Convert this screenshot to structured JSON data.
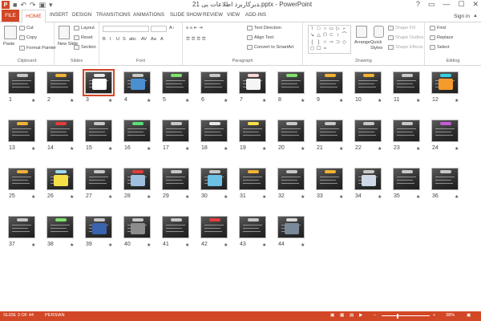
{
  "window": {
    "title": "ﺪﺑﺮﻛﺎﺭﺑﺮﺩ ﺍﻃﻼﻋﺎﺕ ﺑﯽ 21.pptx - PowerPoint",
    "app_logo": "P",
    "qat": [
      "save-icon",
      "undo-icon",
      "redo-icon",
      "start-from-beginning-icon",
      "customize-icon"
    ],
    "controls": [
      "?",
      "restore-icon",
      "minimize-icon",
      "maximize-icon",
      "close-icon"
    ]
  },
  "tabs": {
    "file": "FILE",
    "home": "HOME",
    "others": [
      "INSERT",
      "DESIGN",
      "TRANSITIONS",
      "ANIMATIONS",
      "SLIDE SHOW",
      "REVIEW",
      "VIEW",
      "ADD-INS"
    ],
    "signin": "Sign in"
  },
  "ribbon": {
    "clipboard": {
      "paste": "Paste",
      "cut": "Cut",
      "copy": "Copy",
      "format_painter": "Format Painter",
      "label": "Clipboard"
    },
    "slides": {
      "new_slide": "New Slide",
      "layout": "Layout",
      "reset": "Reset",
      "section": "Section",
      "label": "Slides"
    },
    "font": {
      "label": "Font",
      "buttons": [
        "B",
        "I",
        "U",
        "S",
        "abc",
        "AV",
        "Aa",
        "A"
      ]
    },
    "paragraph": {
      "label": "Paragraph",
      "text_direction": "Text Direction",
      "align_text": "Align Text",
      "convert_smartart": "Convert to SmartArt"
    },
    "drawing": {
      "label": "Drawing",
      "arrange": "Arrange",
      "quick_styles": "Quick Styles",
      "shape_fill": "Shape Fill",
      "shape_outline": "Shape Outline",
      "shape_effects": "Shape Effects",
      "shapes": [
        "\\",
        "□",
        "○",
        "▭",
        "▷",
        "⌐",
        "↘",
        "△",
        "⬠",
        "⊂",
        "↕",
        "⌒",
        "{",
        "}",
        "☆",
        "⇨",
        "⊃",
        "◇",
        "⬡",
        "☐",
        "≈"
      ]
    },
    "editing": {
      "label": "Editing",
      "find": "Find",
      "replace": "Replace",
      "select": "Select"
    }
  },
  "slides": [
    {
      "n": "1",
      "accent": "#c8c8c8",
      "pic": ""
    },
    {
      "n": "2",
      "accent": "#f2b233",
      "pic": ""
    },
    {
      "n": "3",
      "accent": "#e9e9e9",
      "pic": "#ffffff",
      "selected": true
    },
    {
      "n": "4",
      "accent": "#c8c8c8",
      "pic": "#4a8fd0"
    },
    {
      "n": "5",
      "accent": "#7ee26b",
      "pic": ""
    },
    {
      "n": "6",
      "accent": "#c8c8c8",
      "pic": ""
    },
    {
      "n": "7",
      "accent": "#f7d6d6",
      "pic": "#f5f5f5"
    },
    {
      "n": "8",
      "accent": "#7ee26b",
      "pic": ""
    },
    {
      "n": "9",
      "accent": "#f2b233",
      "pic": ""
    },
    {
      "n": "10",
      "accent": "#f2b233",
      "pic": ""
    },
    {
      "n": "11",
      "accent": "#c8c8c8",
      "pic": ""
    },
    {
      "n": "12",
      "accent": "#35d1e0",
      "pic": "#f59b2c"
    },
    {
      "n": "13",
      "accent": "#f2b233",
      "pic": ""
    },
    {
      "n": "14",
      "accent": "#e53b3b",
      "pic": ""
    },
    {
      "n": "15",
      "accent": "#c8c8c8",
      "pic": ""
    },
    {
      "n": "16",
      "accent": "#58e07a",
      "pic": ""
    },
    {
      "n": "17",
      "accent": "#c8c8c8",
      "pic": ""
    },
    {
      "n": "18",
      "accent": "#e6e6e6",
      "pic": ""
    },
    {
      "n": "19",
      "accent": "#f5e04a",
      "pic": ""
    },
    {
      "n": "20",
      "accent": "#c8c8c8",
      "pic": ""
    },
    {
      "n": "21",
      "accent": "#c8c8c8",
      "pic": ""
    },
    {
      "n": "22",
      "accent": "#c8c8c8",
      "pic": ""
    },
    {
      "n": "23",
      "accent": "#c8c8c8",
      "pic": ""
    },
    {
      "n": "24",
      "accent": "#c65bd6",
      "pic": ""
    },
    {
      "n": "25",
      "accent": "#f2b233",
      "pic": ""
    },
    {
      "n": "26",
      "accent": "#a0d8ef",
      "pic": "#f5e04a"
    },
    {
      "n": "27",
      "accent": "#c8c8c8",
      "pic": ""
    },
    {
      "n": "28",
      "accent": "#e53b3b",
      "pic": "#9fbfe0"
    },
    {
      "n": "29",
      "accent": "#c8c8c8",
      "pic": ""
    },
    {
      "n": "30",
      "accent": "#c8c8c8",
      "pic": "#6cc0e6"
    },
    {
      "n": "31",
      "accent": "#f2b233",
      "pic": ""
    },
    {
      "n": "32",
      "accent": "#c8c8c8",
      "pic": ""
    },
    {
      "n": "33",
      "accent": "#f2b233",
      "pic": ""
    },
    {
      "n": "34",
      "accent": "#c8c8c8",
      "pic": "#cfd8e6"
    },
    {
      "n": "35",
      "accent": "#c8c8c8",
      "pic": ""
    },
    {
      "n": "36",
      "accent": "#c8c8c8",
      "pic": ""
    },
    {
      "n": "37",
      "accent": "#c8c8c8",
      "pic": ""
    },
    {
      "n": "38",
      "accent": "#7ee26b",
      "pic": ""
    },
    {
      "n": "39",
      "accent": "#c8c8c8",
      "pic": "#3a63b0"
    },
    {
      "n": "40",
      "accent": "#c8c8c8",
      "pic": "#8c8c8c"
    },
    {
      "n": "41",
      "accent": "#c8c8c8",
      "pic": ""
    },
    {
      "n": "42",
      "accent": "#e53b3b",
      "pic": ""
    },
    {
      "n": "43",
      "accent": "#c8c8c8",
      "pic": ""
    },
    {
      "n": "44",
      "accent": "#d9d9d9",
      "pic": "#7a8a99"
    }
  ],
  "status": {
    "slide_of": "SLIDE 3 OF 44",
    "language": "PERSIAN",
    "zoom": "38%"
  },
  "colors": {
    "accent": "#d24726",
    "status_bar": "#d24726"
  }
}
